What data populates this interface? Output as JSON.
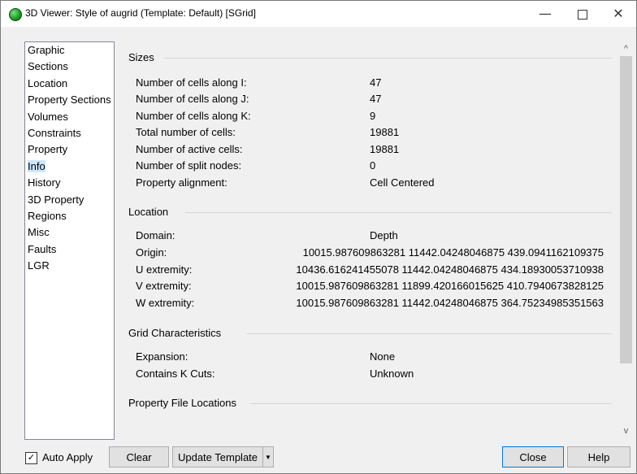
{
  "window": {
    "title": "3D Viewer: Style of augrid (Template: Default) [SGrid]",
    "controls": {
      "minimize": "—",
      "close": "✕"
    }
  },
  "nav": {
    "items": [
      {
        "label": "Graphic"
      },
      {
        "label": "Sections"
      },
      {
        "label": "Location"
      },
      {
        "label": "Property Sections"
      },
      {
        "label": "Volumes"
      },
      {
        "label": "Constraints"
      },
      {
        "label": "Property"
      },
      {
        "label": "Info",
        "selected": true
      },
      {
        "label": "History"
      },
      {
        "label": "3D Property"
      },
      {
        "label": "Regions"
      },
      {
        "label": "Misc"
      },
      {
        "label": "Faults"
      },
      {
        "label": "LGR"
      }
    ],
    "selected_color": "#cce8ff"
  },
  "info": {
    "sizes": {
      "title": "Sizes",
      "rows": [
        {
          "label": "Number of cells along I:",
          "value": "47"
        },
        {
          "label": "Number of cells along J:",
          "value": "47"
        },
        {
          "label": "Number of cells along K:",
          "value": "9"
        },
        {
          "label": "Total number of cells:",
          "value": "19881"
        },
        {
          "label": "Number of active cells:",
          "value": "19881"
        },
        {
          "label": "Number of split nodes:",
          "value": "0"
        },
        {
          "label": "Property alignment:",
          "value": "Cell Centered"
        }
      ]
    },
    "location": {
      "title": "Location",
      "rows": [
        {
          "label": "Domain:",
          "value": "Depth"
        },
        {
          "label": "Origin:",
          "value": "10015.987609863281 11442.04248046875 439.0941162109375"
        },
        {
          "label": "U extremity:",
          "value": "10436.616241455078 11442.04248046875 434.18930053710938"
        },
        {
          "label": "V extremity:",
          "value": "10015.987609863281 11899.420166015625 410.7940673828125"
        },
        {
          "label": "W extremity:",
          "value": "10015.987609863281 11442.04248046875 364.75234985351563"
        }
      ]
    },
    "grid": {
      "title": "Grid Characteristics",
      "rows": [
        {
          "label": "Expansion:",
          "value": "None"
        },
        {
          "label": "Contains K Cuts:",
          "value": "Unknown"
        }
      ]
    },
    "property_files": {
      "title": "Property File Locations"
    }
  },
  "scroll": {
    "up": "^",
    "down": "v"
  },
  "bottom": {
    "auto_apply_label": "Auto Apply",
    "auto_apply_checked": "✓",
    "clear_label": "Clear",
    "update_template_label": "Update Template",
    "dropdown_arrow": "▼",
    "close_label": "Close",
    "help_label": "Help",
    "focus_color": "#0078d7"
  }
}
